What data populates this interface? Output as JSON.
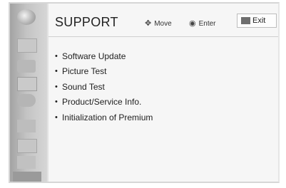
{
  "header": {
    "title": "SUPPORT",
    "move_label": "Move",
    "move_icon": "four-way-arrow-icon",
    "enter_label": "Enter",
    "enter_icon": "ok-button-icon",
    "exit_label": "Exit",
    "exit_icon": "exit-key-icon"
  },
  "menu": {
    "bullet": "•",
    "items": [
      {
        "label": "Software Update"
      },
      {
        "label": "Picture Test"
      },
      {
        "label": "Sound Test"
      },
      {
        "label": "Product/Service Info."
      },
      {
        "label": "Initialization of Premium"
      }
    ]
  },
  "sidebar": {
    "icons": [
      "logo-icon",
      "picture-icon",
      "audio-icon",
      "channel-icon",
      "time-icon",
      "lock-icon",
      "option-icon",
      "input-icon",
      "support-icon"
    ],
    "selected": "support-icon"
  },
  "colors": {
    "panel_background": "#f6f6f6",
    "sidebar_background": "#bdbdbd",
    "text": "#222222"
  }
}
